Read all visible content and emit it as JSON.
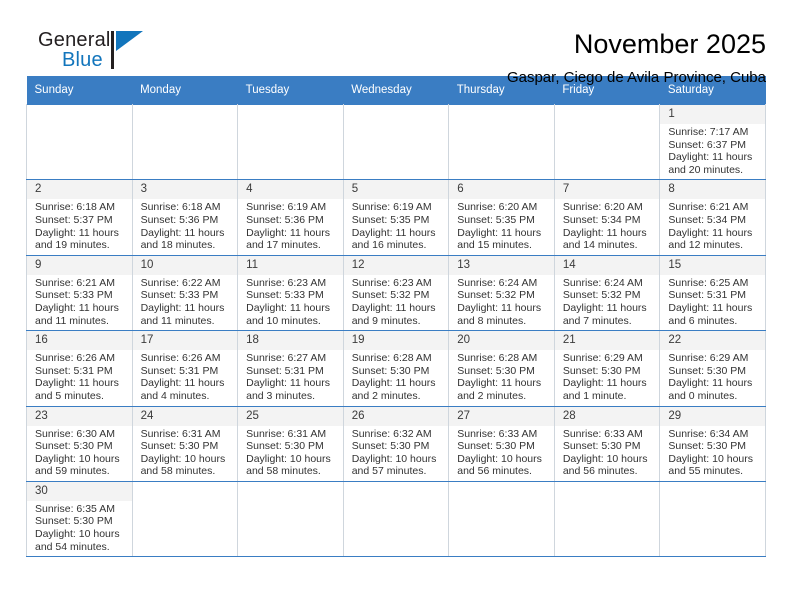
{
  "logo": {
    "word1": "General",
    "word2": "Blue",
    "triangle_color": "#1275bc",
    "text_color": "#231f20"
  },
  "header": {
    "title": "November 2025",
    "subtitle": "Gaspar, Ciego de Avila Province, Cuba"
  },
  "theme": {
    "header_bg": "#3a7dc3",
    "header_text": "#ffffff",
    "daynum_bg": "#f3f3f3",
    "grid_line": "#cfd6dd",
    "week_line": "#3a7dc3"
  },
  "weekday_headers": [
    "Sunday",
    "Monday",
    "Tuesday",
    "Wednesday",
    "Thursday",
    "Friday",
    "Saturday"
  ],
  "weeks": [
    [
      {
        "blank": true
      },
      {
        "blank": true
      },
      {
        "blank": true
      },
      {
        "blank": true
      },
      {
        "blank": true
      },
      {
        "blank": true
      },
      {
        "day": "1",
        "sunrise": "Sunrise: 7:17 AM",
        "sunset": "Sunset: 6:37 PM",
        "daylight1": "Daylight: 11 hours",
        "daylight2": "and 20 minutes."
      }
    ],
    [
      {
        "day": "2",
        "sunrise": "Sunrise: 6:18 AM",
        "sunset": "Sunset: 5:37 PM",
        "daylight1": "Daylight: 11 hours",
        "daylight2": "and 19 minutes."
      },
      {
        "day": "3",
        "sunrise": "Sunrise: 6:18 AM",
        "sunset": "Sunset: 5:36 PM",
        "daylight1": "Daylight: 11 hours",
        "daylight2": "and 18 minutes."
      },
      {
        "day": "4",
        "sunrise": "Sunrise: 6:19 AM",
        "sunset": "Sunset: 5:36 PM",
        "daylight1": "Daylight: 11 hours",
        "daylight2": "and 17 minutes."
      },
      {
        "day": "5",
        "sunrise": "Sunrise: 6:19 AM",
        "sunset": "Sunset: 5:35 PM",
        "daylight1": "Daylight: 11 hours",
        "daylight2": "and 16 minutes."
      },
      {
        "day": "6",
        "sunrise": "Sunrise: 6:20 AM",
        "sunset": "Sunset: 5:35 PM",
        "daylight1": "Daylight: 11 hours",
        "daylight2": "and 15 minutes."
      },
      {
        "day": "7",
        "sunrise": "Sunrise: 6:20 AM",
        "sunset": "Sunset: 5:34 PM",
        "daylight1": "Daylight: 11 hours",
        "daylight2": "and 14 minutes."
      },
      {
        "day": "8",
        "sunrise": "Sunrise: 6:21 AM",
        "sunset": "Sunset: 5:34 PM",
        "daylight1": "Daylight: 11 hours",
        "daylight2": "and 12 minutes."
      }
    ],
    [
      {
        "day": "9",
        "sunrise": "Sunrise: 6:21 AM",
        "sunset": "Sunset: 5:33 PM",
        "daylight1": "Daylight: 11 hours",
        "daylight2": "and 11 minutes."
      },
      {
        "day": "10",
        "sunrise": "Sunrise: 6:22 AM",
        "sunset": "Sunset: 5:33 PM",
        "daylight1": "Daylight: 11 hours",
        "daylight2": "and 11 minutes."
      },
      {
        "day": "11",
        "sunrise": "Sunrise: 6:23 AM",
        "sunset": "Sunset: 5:33 PM",
        "daylight1": "Daylight: 11 hours",
        "daylight2": "and 10 minutes."
      },
      {
        "day": "12",
        "sunrise": "Sunrise: 6:23 AM",
        "sunset": "Sunset: 5:32 PM",
        "daylight1": "Daylight: 11 hours",
        "daylight2": "and 9 minutes."
      },
      {
        "day": "13",
        "sunrise": "Sunrise: 6:24 AM",
        "sunset": "Sunset: 5:32 PM",
        "daylight1": "Daylight: 11 hours",
        "daylight2": "and 8 minutes."
      },
      {
        "day": "14",
        "sunrise": "Sunrise: 6:24 AM",
        "sunset": "Sunset: 5:32 PM",
        "daylight1": "Daylight: 11 hours",
        "daylight2": "and 7 minutes."
      },
      {
        "day": "15",
        "sunrise": "Sunrise: 6:25 AM",
        "sunset": "Sunset: 5:31 PM",
        "daylight1": "Daylight: 11 hours",
        "daylight2": "and 6 minutes."
      }
    ],
    [
      {
        "day": "16",
        "sunrise": "Sunrise: 6:26 AM",
        "sunset": "Sunset: 5:31 PM",
        "daylight1": "Daylight: 11 hours",
        "daylight2": "and 5 minutes."
      },
      {
        "day": "17",
        "sunrise": "Sunrise: 6:26 AM",
        "sunset": "Sunset: 5:31 PM",
        "daylight1": "Daylight: 11 hours",
        "daylight2": "and 4 minutes."
      },
      {
        "day": "18",
        "sunrise": "Sunrise: 6:27 AM",
        "sunset": "Sunset: 5:31 PM",
        "daylight1": "Daylight: 11 hours",
        "daylight2": "and 3 minutes."
      },
      {
        "day": "19",
        "sunrise": "Sunrise: 6:28 AM",
        "sunset": "Sunset: 5:30 PM",
        "daylight1": "Daylight: 11 hours",
        "daylight2": "and 2 minutes."
      },
      {
        "day": "20",
        "sunrise": "Sunrise: 6:28 AM",
        "sunset": "Sunset: 5:30 PM",
        "daylight1": "Daylight: 11 hours",
        "daylight2": "and 2 minutes."
      },
      {
        "day": "21",
        "sunrise": "Sunrise: 6:29 AM",
        "sunset": "Sunset: 5:30 PM",
        "daylight1": "Daylight: 11 hours",
        "daylight2": "and 1 minute."
      },
      {
        "day": "22",
        "sunrise": "Sunrise: 6:29 AM",
        "sunset": "Sunset: 5:30 PM",
        "daylight1": "Daylight: 11 hours",
        "daylight2": "and 0 minutes."
      }
    ],
    [
      {
        "day": "23",
        "sunrise": "Sunrise: 6:30 AM",
        "sunset": "Sunset: 5:30 PM",
        "daylight1": "Daylight: 10 hours",
        "daylight2": "and 59 minutes."
      },
      {
        "day": "24",
        "sunrise": "Sunrise: 6:31 AM",
        "sunset": "Sunset: 5:30 PM",
        "daylight1": "Daylight: 10 hours",
        "daylight2": "and 58 minutes."
      },
      {
        "day": "25",
        "sunrise": "Sunrise: 6:31 AM",
        "sunset": "Sunset: 5:30 PM",
        "daylight1": "Daylight: 10 hours",
        "daylight2": "and 58 minutes."
      },
      {
        "day": "26",
        "sunrise": "Sunrise: 6:32 AM",
        "sunset": "Sunset: 5:30 PM",
        "daylight1": "Daylight: 10 hours",
        "daylight2": "and 57 minutes."
      },
      {
        "day": "27",
        "sunrise": "Sunrise: 6:33 AM",
        "sunset": "Sunset: 5:30 PM",
        "daylight1": "Daylight: 10 hours",
        "daylight2": "and 56 minutes."
      },
      {
        "day": "28",
        "sunrise": "Sunrise: 6:33 AM",
        "sunset": "Sunset: 5:30 PM",
        "daylight1": "Daylight: 10 hours",
        "daylight2": "and 56 minutes."
      },
      {
        "day": "29",
        "sunrise": "Sunrise: 6:34 AM",
        "sunset": "Sunset: 5:30 PM",
        "daylight1": "Daylight: 10 hours",
        "daylight2": "and 55 minutes."
      }
    ],
    [
      {
        "day": "30",
        "sunrise": "Sunrise: 6:35 AM",
        "sunset": "Sunset: 5:30 PM",
        "daylight1": "Daylight: 10 hours",
        "daylight2": "and 54 minutes."
      },
      {
        "blank": true
      },
      {
        "blank": true
      },
      {
        "blank": true
      },
      {
        "blank": true
      },
      {
        "blank": true
      },
      {
        "blank": true
      }
    ]
  ]
}
